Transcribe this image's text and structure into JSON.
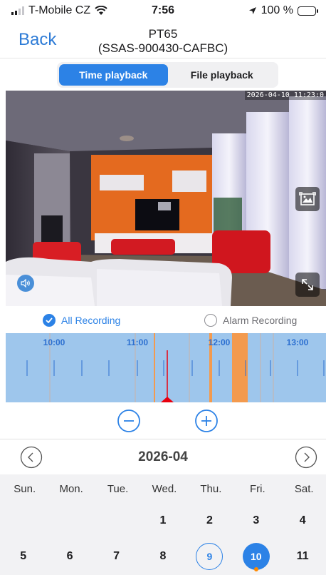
{
  "status_bar": {
    "carrier": "T-Mobile CZ",
    "time": "7:56",
    "battery": "100 %"
  },
  "nav": {
    "back_label": "Back",
    "title_line1": "PT65",
    "title_line2": "(SSAS-900430-CAFBC)"
  },
  "segment": {
    "time_playback": "Time playback",
    "file_playback": "File playback"
  },
  "video": {
    "timestamp": "2026-04-10 11:23:0"
  },
  "recording": {
    "all_label": "All Recording",
    "alarm_label": "Alarm Recording"
  },
  "timeline": {
    "labels": [
      "10:00",
      "11:00",
      "12:00",
      "13:00"
    ],
    "colors": {
      "background": "#9ec6ec",
      "alarm": "#f39a4e",
      "cursor": "#e8000e"
    }
  },
  "calendar": {
    "month": "2026-04",
    "weekdays": [
      "Sun.",
      "Mon.",
      "Tue.",
      "Wed.",
      "Thu.",
      "Fri.",
      "Sat."
    ],
    "row1": [
      "",
      "",
      "",
      "1",
      "2",
      "3",
      "4"
    ],
    "row2": [
      "5",
      "6",
      "7",
      "8",
      "9",
      "10",
      "11"
    ]
  },
  "colors": {
    "accent": "#2c82e6",
    "back_link": "#2d7bd6",
    "record_dot": "#ff8a00"
  }
}
